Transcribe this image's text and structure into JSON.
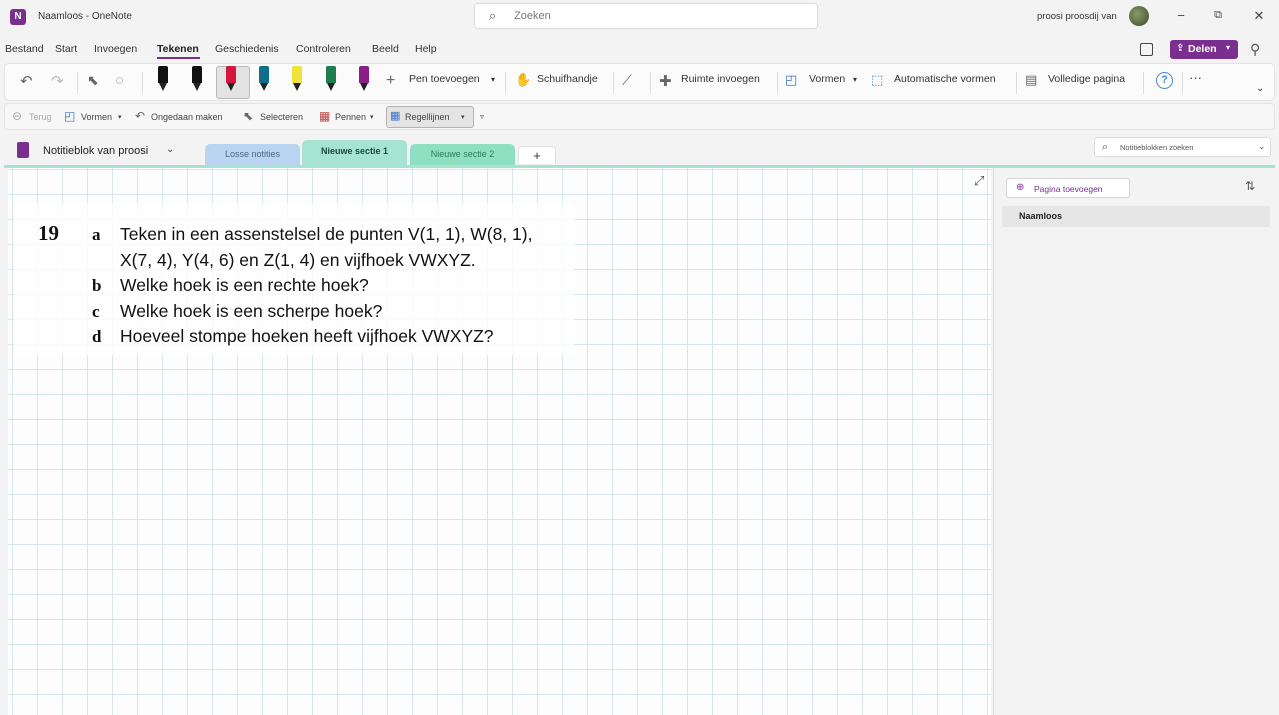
{
  "window": {
    "title": "Naamloos - OneNote",
    "search_placeholder": "Zoeken",
    "user_name": "proosi proosdij van",
    "minimize": "−",
    "restore": "⧉",
    "close": "✕"
  },
  "menu": {
    "items": [
      "Bestand",
      "Start",
      "Invoegen",
      "Tekenen",
      "Geschiedenis",
      "Controleren",
      "Beeld",
      "Help"
    ],
    "active": "Tekenen",
    "share_label": "Delen"
  },
  "ribbon": {
    "add_pen": "Pen toevoegen",
    "hand": "Schuifhandje",
    "insert_space": "Ruimte invoegen",
    "shapes": "Vormen",
    "auto_shapes": "Automatische vormen",
    "full_page": "Volledige pagina",
    "help": "?",
    "more": "···",
    "pen_colors": [
      "#111111",
      "#111111",
      "#d4163c",
      "#0f6f8a",
      "#f2e33a",
      "#1d7d4c",
      "#8a1f8a"
    ]
  },
  "quickbar": {
    "back": "Terug",
    "shapes": "Vormen",
    "undo": "Ongedaan maken",
    "select": "Selecteren",
    "pens": "Pennen",
    "ruled_lines": "Regellijnen"
  },
  "notebook": {
    "name": "Notitieblok van proosi",
    "tabs": [
      {
        "label": "Losse notities",
        "color": "#b9d4f0"
      },
      {
        "label": "Nieuwe sectie 1",
        "color": "#a6e3d2"
      },
      {
        "label": "Nieuwe sectie 2",
        "color": "#8fe0c2"
      }
    ],
    "add_tab": "+",
    "search_placeholder": "Notitieblokken zoeken"
  },
  "exercise": {
    "number": "19",
    "a_letter": "a",
    "a_line1": "Teken in een assenstelsel de punten V(1, 1), W(8, 1),",
    "a_line2": "X(7, 4), Y(4, 6) en Z(1, 4) en vijfhoek VWXYZ.",
    "b_letter": "b",
    "b_text": "Welke hoek is een rechte hoek?",
    "c_letter": "c",
    "c_text": "Welke hoek is een scherpe hoek?",
    "d_letter": "d",
    "d_text": "Hoeveel stompe hoeken heeft vijfhoek VWXYZ?"
  },
  "page_panel": {
    "add_page": "Pagina toevoegen",
    "pages": [
      "Naamloos"
    ]
  }
}
